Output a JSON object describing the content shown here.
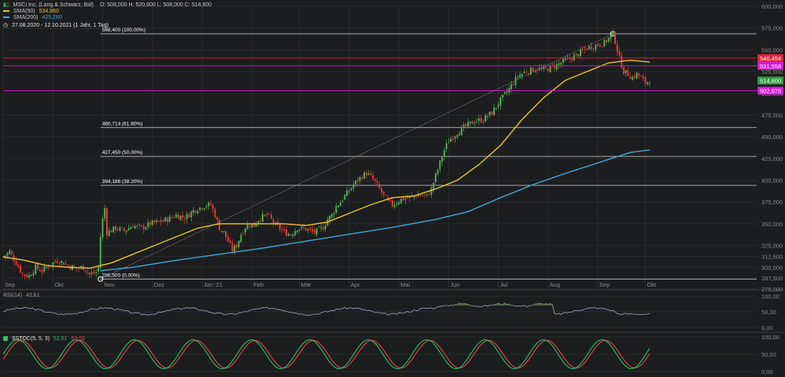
{
  "header": {
    "title": "MSCI Inc. (Lang & Schwarz, Bid)",
    "ohlc": "O: 508,000  H: 520,600  L: 508,000  C: 514,600",
    "sma50_label": "SMA(50)",
    "sma50_value": "534,860",
    "sma200_label": "SMA(200)",
    "sma200_value": "425,280",
    "range": "27.08.2020 - 12.10.2021  (1 Jahr, 1 Tag)"
  },
  "colors": {
    "background": "#1c1d1f",
    "candle_up": "#4caf50",
    "candle_down": "#e53935",
    "sma50": "#f0c419",
    "sma200": "#3aa9d8",
    "rsi_line": "#9ea3c9",
    "rsi_fill": "#4e6b2e",
    "stoch_k": "#22c55e",
    "stoch_d": "#ef4444",
    "res_line_red": "#e0253a",
    "res_line_magenta": "#d81bd8"
  },
  "chart_data": {
    "type": "candlestick",
    "ylim": [
      275,
      600
    ],
    "y_ticks": [
      "600,000",
      "575,000",
      "550,000",
      "525,000",
      "500,000",
      "475,000",
      "450,000",
      "425,000",
      "400,000",
      "375,000",
      "350,000",
      "325,000",
      "312,500",
      "300,000",
      "287,500",
      "275,000"
    ],
    "x_labels": [
      "Sep",
      "Okt",
      "Nov",
      "Dez",
      "Jan '21",
      "Feb",
      "Mär",
      "Apr",
      "Mai",
      "Jun",
      "Jul",
      "Aug",
      "Sep",
      "Okt"
    ],
    "fib_levels": [
      {
        "label": "568,400 (100.00%)",
        "value": 568.4
      },
      {
        "label": "460,714 (61.80%)",
        "value": 460.714
      },
      {
        "label": "427,450 (50.00%)",
        "value": 427.45
      },
      {
        "label": "394,186 (38.20%)",
        "value": 394.186
      },
      {
        "label": "286,500 (0.00%)",
        "value": 286.5
      }
    ],
    "price_badges": [
      {
        "label": "540,454",
        "value": 540.454,
        "color": "#e0253a"
      },
      {
        "label": "531,558",
        "value": 531.558,
        "color": "#d81bd8"
      },
      {
        "label": "514,600",
        "value": 514.6,
        "color": "#2e9e3e"
      },
      {
        "label": "502,975",
        "value": 502.975,
        "color": "#d81bd8"
      }
    ],
    "price_path": [
      [
        0,
        312
      ],
      [
        3,
        318
      ],
      [
        6,
        305
      ],
      [
        9,
        292
      ],
      [
        12,
        290
      ],
      [
        15,
        300
      ],
      [
        18,
        296
      ],
      [
        21,
        302
      ],
      [
        25,
        308
      ],
      [
        28,
        305
      ],
      [
        31,
        301
      ],
      [
        34,
        299
      ],
      [
        37,
        300
      ],
      [
        40,
        292
      ],
      [
        43,
        294
      ],
      [
        44,
        300
      ],
      [
        45,
        335
      ],
      [
        46,
        355
      ],
      [
        47,
        368
      ],
      [
        48,
        340
      ],
      [
        52,
        345
      ],
      [
        56,
        342
      ],
      [
        60,
        348
      ],
      [
        64,
        345
      ],
      [
        68,
        350
      ],
      [
        72,
        352
      ],
      [
        76,
        355
      ],
      [
        80,
        360
      ],
      [
        84,
        357
      ],
      [
        88,
        365
      ],
      [
        92,
        370
      ],
      [
        96,
        372
      ],
      [
        98,
        360
      ],
      [
        100,
        345
      ],
      [
        102,
        340
      ],
      [
        104,
        330
      ],
      [
        106,
        320
      ],
      [
        108,
        325
      ],
      [
        110,
        338
      ],
      [
        112,
        346
      ],
      [
        114,
        350
      ],
      [
        116,
        348
      ],
      [
        118,
        355
      ],
      [
        120,
        358
      ],
      [
        122,
        360
      ],
      [
        124,
        355
      ],
      [
        126,
        348
      ],
      [
        128,
        345
      ],
      [
        130,
        340
      ],
      [
        133,
        338
      ],
      [
        136,
        345
      ],
      [
        140,
        344
      ],
      [
        144,
        340
      ],
      [
        148,
        346
      ],
      [
        150,
        355
      ],
      [
        152,
        360
      ],
      [
        154,
        370
      ],
      [
        156,
        375
      ],
      [
        158,
        382
      ],
      [
        160,
        388
      ],
      [
        162,
        395
      ],
      [
        164,
        400
      ],
      [
        166,
        405
      ],
      [
        168,
        408
      ],
      [
        170,
        404
      ],
      [
        172,
        398
      ],
      [
        174,
        390
      ],
      [
        176,
        382
      ],
      [
        178,
        375
      ],
      [
        180,
        372
      ],
      [
        184,
        378
      ],
      [
        188,
        380
      ],
      [
        192,
        383
      ],
      [
        196,
        382
      ],
      [
        198,
        390
      ],
      [
        200,
        405
      ],
      [
        202,
        420
      ],
      [
        204,
        435
      ],
      [
        206,
        445
      ],
      [
        208,
        450
      ],
      [
        210,
        455
      ],
      [
        214,
        462
      ],
      [
        218,
        468
      ],
      [
        222,
        470
      ],
      [
        226,
        478
      ],
      [
        230,
        492
      ],
      [
        234,
        505
      ],
      [
        238,
        520
      ],
      [
        242,
        525
      ],
      [
        246,
        528
      ],
      [
        250,
        527
      ],
      [
        254,
        530
      ],
      [
        258,
        535
      ],
      [
        262,
        540
      ],
      [
        266,
        545
      ],
      [
        270,
        552
      ],
      [
        274,
        555
      ],
      [
        278,
        558
      ],
      [
        280,
        563
      ],
      [
        282,
        568
      ],
      [
        283,
        560
      ],
      [
        285,
        540
      ],
      [
        287,
        525
      ],
      [
        289,
        522
      ],
      [
        291,
        518
      ],
      [
        293,
        522
      ],
      [
        295,
        518
      ],
      [
        297,
        512
      ],
      [
        299,
        515
      ]
    ],
    "sma50_path": [
      [
        0,
        312
      ],
      [
        10,
        308
      ],
      [
        20,
        302
      ],
      [
        30,
        300
      ],
      [
        40,
        299
      ],
      [
        50,
        305
      ],
      [
        60,
        315
      ],
      [
        70,
        325
      ],
      [
        80,
        335
      ],
      [
        90,
        345
      ],
      [
        100,
        350
      ],
      [
        110,
        350
      ],
      [
        120,
        350
      ],
      [
        130,
        350
      ],
      [
        140,
        348
      ],
      [
        150,
        352
      ],
      [
        160,
        362
      ],
      [
        170,
        372
      ],
      [
        180,
        380
      ],
      [
        190,
        382
      ],
      [
        200,
        390
      ],
      [
        210,
        400
      ],
      [
        220,
        418
      ],
      [
        230,
        440
      ],
      [
        240,
        470
      ],
      [
        250,
        495
      ],
      [
        260,
        515
      ],
      [
        270,
        525
      ],
      [
        280,
        535
      ],
      [
        290,
        538
      ],
      [
        299,
        536
      ]
    ],
    "sma200_path": [
      [
        45,
        296
      ],
      [
        60,
        300
      ],
      [
        80,
        308
      ],
      [
        100,
        315
      ],
      [
        120,
        322
      ],
      [
        140,
        330
      ],
      [
        160,
        338
      ],
      [
        180,
        346
      ],
      [
        200,
        355
      ],
      [
        215,
        364
      ],
      [
        230,
        380
      ],
      [
        245,
        395
      ],
      [
        260,
        408
      ],
      [
        275,
        420
      ],
      [
        290,
        432
      ],
      [
        299,
        435
      ]
    ],
    "fib_trend": [
      [
        45,
        286.5
      ],
      [
        282,
        568.4
      ]
    ],
    "rsi": {
      "label": "RSI(14)",
      "value": "42,61",
      "ticks": [
        "100,00",
        "50,00",
        "0,00"
      ]
    },
    "stoch": {
      "label": "SSTOC(5, 5, 3)",
      "k_value": "52,61",
      "d_value": "53,02",
      "ticks": [
        "100,00",
        "50,00",
        "0,00"
      ]
    }
  }
}
